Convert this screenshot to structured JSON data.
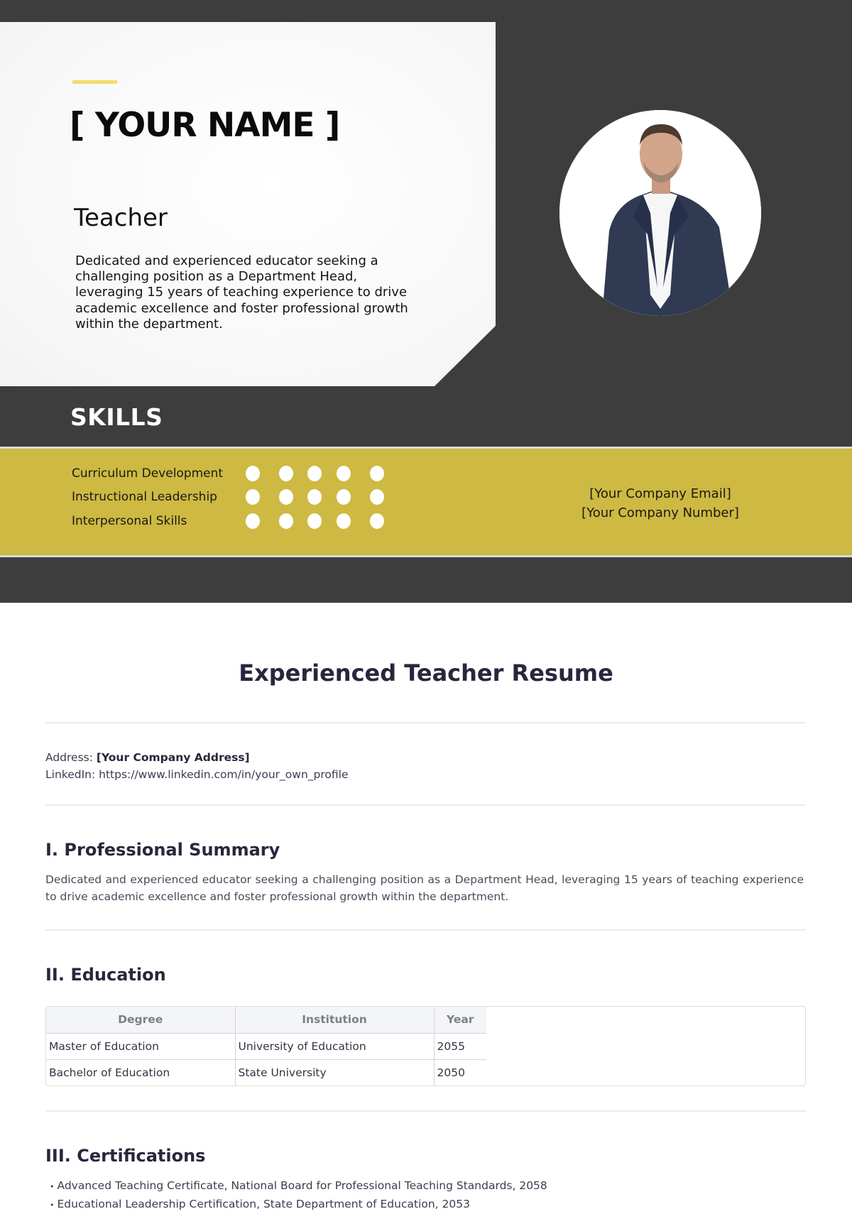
{
  "hero": {
    "name": "[ YOUR NAME ]",
    "role": "Teacher",
    "summary": "Dedicated and experienced educator seeking a challenging position as a Department Head, leveraging 15 years of teaching experience to drive academic excellence and foster professional growth within the department.",
    "photo_alt": "Professional headshot of a man in a navy suit",
    "colors": {
      "dark_background": "#3d3d3d",
      "accent_yellow": "#f2dd6c",
      "band_gold": "#ceb943"
    }
  },
  "skills": {
    "title": "SKILLS",
    "items": [
      {
        "label": "Curriculum Development",
        "rating": 5,
        "max": 5
      },
      {
        "label": "Instructional Leadership",
        "rating": 5,
        "max": 5
      },
      {
        "label": "Interpersonal Skills",
        "rating": 5,
        "max": 5
      }
    ],
    "contact_email": "[Your Company Email]",
    "contact_number": "[Your Company Number]"
  },
  "document": {
    "title": "Experienced Teacher Resume",
    "address_label": "Address:",
    "address_value": "[Your Company Address]",
    "linkedin_label": "LinkedIn:",
    "linkedin_value": "https://www.linkedin.com/in/your_own_profile",
    "sections": {
      "summary": {
        "heading": "I. Professional Summary",
        "text": "Dedicated and experienced educator seeking a challenging position as a Department Head, leveraging 15 years of teaching experience to drive academic excellence and foster professional growth within the department."
      },
      "education": {
        "heading": "II. Education",
        "columns": [
          "Degree",
          "Institution",
          "Year"
        ],
        "rows": [
          [
            "Master of Education",
            "University of Education",
            "2055"
          ],
          [
            "Bachelor of Education",
            "State University",
            "2050"
          ]
        ]
      },
      "certifications": {
        "heading": "III. Certifications",
        "items": [
          "Advanced Teaching Certificate, National Board for Professional Teaching Standards, 2058",
          "Educational Leadership Certification, State Department of Education, 2053"
        ]
      }
    }
  }
}
